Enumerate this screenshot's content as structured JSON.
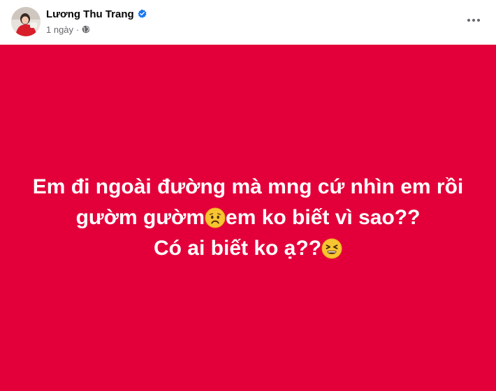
{
  "post": {
    "author": {
      "name": "Lương Thu Trang",
      "verified": true,
      "avatar_icon": "avatar-photo"
    },
    "meta": {
      "time": "1 ngày",
      "separator": "·",
      "audience_icon": "globe-icon"
    },
    "more_icon": "more-horizontal-icon",
    "status": {
      "background_color": "#e3003a",
      "text_color": "#ffffff",
      "line1": "Em đi ngoài đường mà mng cứ nhìn em rồi",
      "line2_part1": "gườm gườm",
      "line2_emoji": "worried-face-emoji",
      "line2_part2": "em ko biết vì sao??",
      "line3_part1": "Có ai biết ko ạ??",
      "line3_emoji": "tired-face-emoji"
    }
  }
}
